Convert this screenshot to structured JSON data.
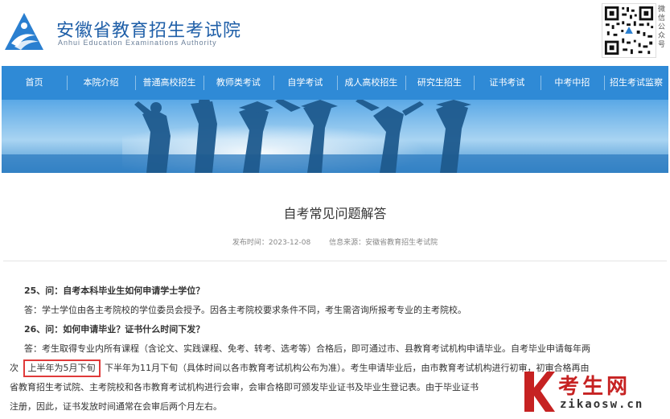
{
  "header": {
    "title": "安徽省教育招生考试院",
    "subtitle": "Anhui Education Examinations Authority",
    "qr_label": "微信公众号"
  },
  "nav": {
    "items": [
      {
        "label": "首页"
      },
      {
        "label": "本院介绍"
      },
      {
        "label": "普通高校招生"
      },
      {
        "label": "教师类考试"
      },
      {
        "label": "自学考试"
      },
      {
        "label": "成人高校招生"
      },
      {
        "label": "研究生招生"
      },
      {
        "label": "证书考试"
      },
      {
        "label": "中考中招"
      },
      {
        "label": "招生考试监察"
      }
    ]
  },
  "article": {
    "title": "自考常见问题解答",
    "publish_time": "发布时间：2023-12-08",
    "source": "信息来源：安徽省教育招生考试院",
    "q25": "25、问：自考本科毕业生如何申请学士学位？",
    "a25": "答：学士学位由各主考院校的学位委员会授予。因各主考院校要求条件不同，考生需咨询所报考专业的主考院校。",
    "q26": "26、问：如何申请毕业？证书什么时间下发？",
    "a26_p1": "答：考生取得专业内所有课程（含论文、实践课程、免考、转考、选考等）合格后，即可通过市、县教育考试机构申请毕业。自考毕业申请每年两",
    "a26_p2a": "次",
    "a26_highlight": "上半年为5月下旬",
    "a26_p2b": "下半年为11月下旬（具体时间以各市教育考试机构公布为准）。考生申请毕业后，由市教育考试机构进行初审，初审合格再由",
    "a26_p3": "省教育招生考试院、主考院校和各市教育考试机构进行会审，会审合格即可颁发毕业证书及毕业生登记表。由于毕业证书",
    "a26_p4": "注册，因此，证书发放时间通常在会审后两个月左右。"
  },
  "watermark": {
    "cn": "考生网",
    "en": "zikaosw.cn"
  },
  "colors": {
    "nav_bg": "#2f8ad6",
    "title_blue": "#1f5fa8",
    "highlight_border": "#e03a3a",
    "watermark_red": "#c62222"
  }
}
